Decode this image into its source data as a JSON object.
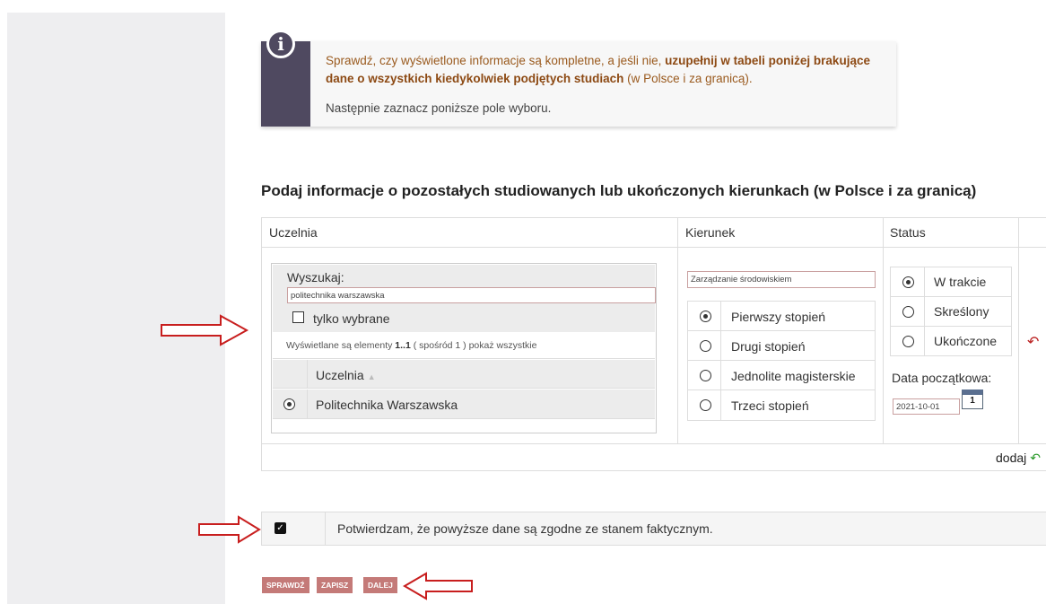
{
  "info": {
    "text_before": "Sprawdź, czy wyświetlone informacje są kompletne, a jeśli nie, ",
    "text_bold": "uzupełnij w tabeli poniżej brakujące dane o wszystkich kiedykolwiek podjętych studiach",
    "text_after": " (w Polsce i za granicą).",
    "text2": "Następnie zaznacz poniższe pole wyboru.",
    "icon": "info-icon"
  },
  "section_title": "Podaj informacje o pozostałych studiowanych lub ukończonych kierunkach (w Polsce i za granicą)",
  "table": {
    "headers": [
      "Uczelnia",
      "Kierunek",
      "Status"
    ],
    "search": {
      "label": "Wyszukaj:",
      "value": "politechnika warszawska",
      "only_selected_label": "tylko wybrane",
      "info_before": "Wyświetlane są elementy ",
      "info_range": "1..1",
      "info_after": " ( spośród 1 ) pokaż wszystkie",
      "result_header": "Uczelnia",
      "results": [
        "Politechnika Warszawska"
      ]
    },
    "kierunek": {
      "value": "Zarządzanie środowiskiem",
      "stopnie": [
        "Pierwszy stopień",
        "Drugi stopień",
        "Jednolite magisterskie",
        "Trzeci stopień"
      ],
      "selected": 0
    },
    "status": {
      "options": [
        "W trakcie",
        "Skreślony",
        "Ukończone"
      ],
      "selected": 0,
      "date_label": "Data początkowa:",
      "date_value": "2021-10-01",
      "calendar_day": "1"
    },
    "add_label": "dodaj"
  },
  "confirm": {
    "checked": true,
    "text": "Potwierdzam, że powyższe dane są zgodne ze stanem faktycznym."
  },
  "buttons": {
    "check": "SPRAWDŹ",
    "save": "ZAPISZ",
    "next": "DALEJ"
  },
  "colors": {
    "accent": "#c47a78",
    "info_stripe": "#4f4960",
    "info_text": "#9a5a1e",
    "arrow": "#c81e1e"
  }
}
